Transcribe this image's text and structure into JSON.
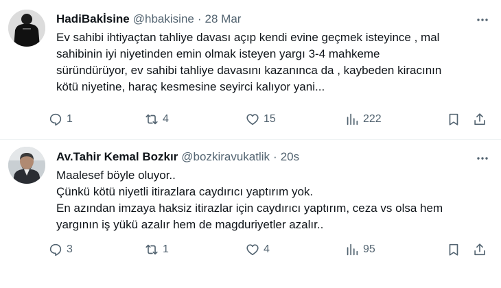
{
  "colors": {
    "text": "#0f1419",
    "secondary": "#536471",
    "divider": "#eff3f4"
  },
  "tweets": [
    {
      "name": "HadiBakİsine",
      "handle": "@hbakisine",
      "separator": "·",
      "time": "28 Mar",
      "lines": [
        "Ev sahibi ihtiyaçtan tahliye davası açıp kendi evine geçmek isteyince , mal",
        "sahibinin iyi niyetinden emin olmak isteyen yargı 3-4 mahkeme",
        "süründürüyor, ev sahibi tahliye davasını kazanınca da  , kaybeden kiracının",
        "kötü niyetine, haraç kesmesine  seyirci kalıyor yani..."
      ],
      "stats": {
        "replies": "1",
        "reposts": "4",
        "likes": "15",
        "views": "222"
      },
      "icons": [
        "reply-icon",
        "repost-icon",
        "like-icon",
        "views-icon",
        "bookmark-icon",
        "share-icon"
      ]
    },
    {
      "name": "Av.Tahir Kemal Bozkır",
      "handle": "@bozkiravukatlik",
      "separator": "·",
      "time": "20s",
      "lines": [
        "Maalesef böyle oluyor..",
        "Çünkü kötü niyetli itirazlara caydırıcı yaptırım yok.",
        "En azından imzaya haksiz itirazlar için caydırıcı yaptırım, ceza vs olsa hem",
        "yargının iş yükü azalır hem de magduriyetler azalır.."
      ],
      "stats": {
        "replies": "3",
        "reposts": "1",
        "likes": "4",
        "views": "95"
      },
      "icons": [
        "reply-icon",
        "repost-icon",
        "like-icon",
        "views-icon",
        "bookmark-icon",
        "share-icon"
      ]
    }
  ]
}
